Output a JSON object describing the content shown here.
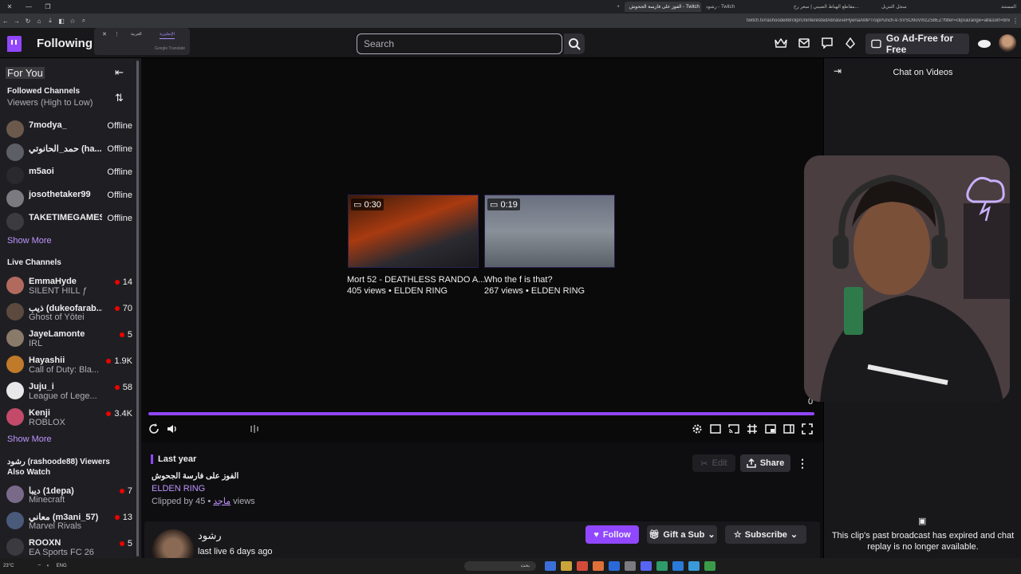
{
  "browser": {
    "tabs": [
      {
        "label": "الفوز على فارسة الجحوش - Twitch",
        "active": true
      },
      {
        "label": "رشود - Twitch",
        "active": false
      },
      {
        "label": "مقاطع الهياط الصيني | سعر رخ...",
        "active": false
      },
      {
        "label": "سجل التنزيل",
        "active": false
      }
    ],
    "right_label": "المستند",
    "url": "twitch.tv/rashoode88/clip/UninterestedAbrasiveHyenaAMPTropPunch-k-SVSO9oVmzZ58EZ?filter=clips&range=all&sort=time"
  },
  "translate_popup": {
    "lang_a": "العربية",
    "lang_b": "الإنجليزية",
    "footer": "Google Translate"
  },
  "topnav": {
    "following": "Following",
    "search_placeholder": "Search",
    "adfree_label": "Go Ad-Free for Free"
  },
  "sidebar": {
    "for_you": "For You",
    "followed_header": "Followed Channels",
    "followed_sort": "Viewers (High to Low)",
    "followed": [
      {
        "name": "7modya_",
        "status": "Offline",
        "avatar_color": "#6b5a4c"
      },
      {
        "name": "حمد_الحانوتي (ha...",
        "status": "Offline",
        "avatar_color": "#5e5e66"
      },
      {
        "name": "m5aoi",
        "status": "Offline",
        "avatar_color": "#2a2a2e"
      },
      {
        "name": "josothetaker99",
        "status": "Offline",
        "avatar_color": "#7a7a80"
      },
      {
        "name": "TAKETIMEGAMES",
        "status": "Offline",
        "avatar_color": "#3b3b40"
      }
    ],
    "show_more_1": "Show More",
    "live_header": "Live Channels",
    "live": [
      {
        "name": "EmmaHyde",
        "game": "SILENT HILL ƒ",
        "viewers": "14",
        "avatar_color": "#b36a5e"
      },
      {
        "name": "ذيب (dukeofarab...",
        "game": "Ghost of Yōtei",
        "viewers": "70",
        "avatar_color": "#5c4a3e"
      },
      {
        "name": "JayeLamonte",
        "game": "IRL",
        "viewers": "5",
        "avatar_color": "#8a7a6a"
      },
      {
        "name": "Hayashii",
        "game": "Call of Duty: Bla...",
        "viewers": "1.9K",
        "avatar_color": "#c07a2a"
      },
      {
        "name": "Juju_i",
        "game": "League of Lege...",
        "viewers": "58",
        "avatar_color": "#e8e8ea"
      },
      {
        "name": "Kenji",
        "game": "ROBLOX",
        "viewers": "3.4K",
        "avatar_color": "#c44a6a"
      }
    ],
    "show_more_2": "Show More",
    "also_header": "رشود (rashoode88) Viewers Also Watch",
    "also": [
      {
        "name": "ديبا (1depa)",
        "game": "Minecraft",
        "viewers": "7",
        "avatar_color": "#7a6a8a"
      },
      {
        "name": "معاني (m3ani_57)",
        "game": "Marvel Rivals",
        "viewers": "13",
        "avatar_color": "#4a5a7a"
      },
      {
        "name": "ROOXN",
        "game": "EA Sports FC 26",
        "viewers": "5",
        "avatar_color": "#3a3a40"
      }
    ]
  },
  "player": {
    "videos": [
      {
        "duration": "0:30",
        "title": "Mort 52 - DEATHLESS RANDO A...",
        "meta": "405 views • ELDEN RING"
      },
      {
        "duration": "0:19",
        "title": "Who the f is that?",
        "meta": "267 views • ELDEN RING"
      }
    ],
    "counter": "0"
  },
  "clip": {
    "time_ago": "Last year",
    "title": "الفوز على فارسة الجحوش",
    "game": "ELDEN RING",
    "clipped_by_prefix": "Clipped by",
    "clipper": "ماجد",
    "views": "• 45 views",
    "edit_label": "Edit",
    "share_label": "Share"
  },
  "channel": {
    "name": "رشود",
    "last_live": "last live 6 days ago",
    "follow_label": "Follow",
    "gift_label": "Gift a Sub",
    "subscribe_label": "Subscribe"
  },
  "chat": {
    "title": "Chat on Videos",
    "message": "This clip's past broadcast has expired and chat replay is no longer available."
  },
  "taskbar": {
    "lang": "ENG",
    "weather": "23°C",
    "search_placeholder": "بحث"
  },
  "colors": {
    "accent": "#9147ff",
    "link": "#bf94ff",
    "live": "#eb0400"
  }
}
